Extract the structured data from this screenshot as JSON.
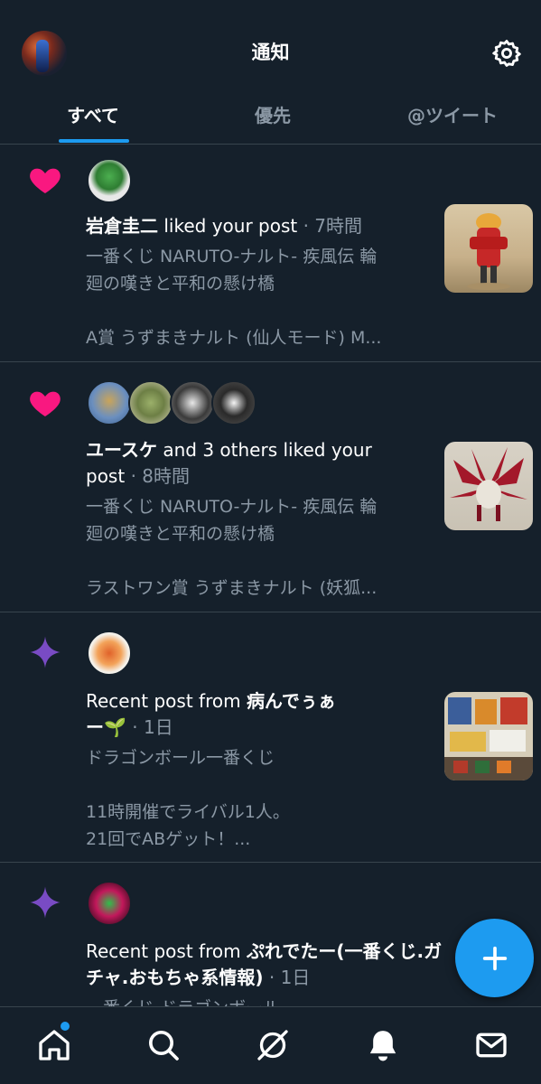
{
  "header": {
    "title": "通知",
    "tabs": [
      "すべて",
      "優先",
      "@ツイート"
    ]
  },
  "notifications": [
    {
      "type": "like",
      "actor": "岩倉圭二",
      "action": " liked your post",
      "time": "· 7時間",
      "post_line1": "一番くじ NARUTO-ナルト- 疾風伝 輪",
      "post_line2": "廻の嘆きと平和の懸け橋",
      "post_line3": "A賞 うずまきナルト (仙人モード) M..."
    },
    {
      "type": "like",
      "actor": "ユースケ",
      "action": " and 3 others liked your",
      "action2": "post",
      "time": "· 8時間",
      "post_line1": "一番くじ NARUTO-ナルト- 疾風伝 輪",
      "post_line2": "廻の嘆きと平和の懸け橋",
      "post_line3": "ラストワン賞 うずまきナルト (妖狐..."
    },
    {
      "type": "recent",
      "prefix": "Recent post from ",
      "actor": "病んでぅぁ",
      "actor2": "ー🌱",
      "time": "· 1日",
      "post_line1": "ドラゴンボール一番くじ",
      "post_line2": "11時開催でライバル1人。",
      "post_line3": "21回でABゲット！..."
    },
    {
      "type": "recent",
      "prefix": "Recent post from ",
      "actor": "ぷれでたー(一番くじ.ガ",
      "actor2": "チャ.おもちゃ系情報)",
      "time": "· 1日",
      "post_line1": "一番くじ ドラゴンボール"
    }
  ],
  "colors": {
    "background": "#15202b",
    "accent": "#1d9bf0",
    "like": "#f91880",
    "recent": "#794bc4",
    "muted": "#8b98a5",
    "divider": "#38444d"
  },
  "icons": {
    "settings": "gear-icon",
    "like": "heart-icon",
    "recent": "sparkle-icon",
    "compose": "plus-icon",
    "home": "home-icon",
    "search": "search-icon",
    "spaces": "spaces-icon",
    "notifications": "bell-icon",
    "messages": "mail-icon"
  }
}
